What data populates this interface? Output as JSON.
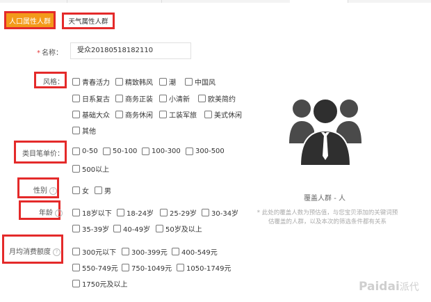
{
  "tabs": {
    "active": "人口属性人群",
    "inactive": "天气属性人群"
  },
  "name": {
    "label": "名称：",
    "value": "受众20180518182110"
  },
  "style": {
    "label": "风格：",
    "options": [
      "青春活力",
      "精致韩风",
      "潮",
      "中国风",
      "日系复古",
      "商务正装",
      "小清新",
      "欧美简约",
      "基础大众",
      "商务休闲",
      "工装军旅",
      "美式休闲",
      "其他"
    ]
  },
  "price": {
    "label": "类目笔单价：",
    "options": [
      "0-50",
      "50-100",
      "100-300",
      "300-500",
      "500以上"
    ]
  },
  "gender": {
    "label": "性别",
    "options": [
      "女",
      "男"
    ]
  },
  "age": {
    "label": "年龄",
    "options": [
      "18岁以下",
      "18-24岁",
      "25-29岁",
      "30-34岁",
      "35-39岁",
      "40-49岁",
      "50岁及以上"
    ]
  },
  "spend": {
    "label": "月均消费额度",
    "options": [
      "300元以下",
      "300-399元",
      "400-549元",
      "550-749元",
      "750-1049元",
      "1050-1749元",
      "1750元及以上"
    ]
  },
  "coverage": {
    "title": "覆盖人群 - 人",
    "note": "* 此处的覆盖人数为预估值，与您宝贝添加的关键词预估覆盖的人群，以及本次的筛选条件都有关系"
  },
  "watermark": {
    "brand": "Paidai",
    "cn": "派代"
  },
  "icons": {
    "help": "question-circle-icon",
    "avatar": "user-group-icon"
  },
  "colors": {
    "accent": "#f39a1a",
    "highlight": "#e42a2a"
  }
}
